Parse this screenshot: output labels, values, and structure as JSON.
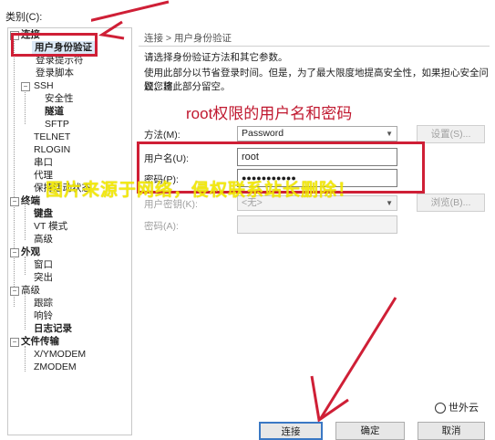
{
  "category_label": "类别(C):",
  "tree": [
    {
      "label": "连接",
      "bold": true
    },
    {
      "label": "用户身份验证",
      "bold": true,
      "selected": true
    },
    {
      "label": "登录提示符"
    },
    {
      "label": "登录脚本"
    },
    {
      "label": "SSH"
    },
    {
      "label": "安全性"
    },
    {
      "label": "隧道",
      "bold": true
    },
    {
      "label": "SFTP"
    },
    {
      "label": "TELNET"
    },
    {
      "label": "RLOGIN"
    },
    {
      "label": "串口"
    },
    {
      "label": "代理"
    },
    {
      "label": "保持活动状态"
    },
    {
      "label": "终端",
      "bold": true
    },
    {
      "label": "键盘",
      "bold": true
    },
    {
      "label": "VT 模式"
    },
    {
      "label": "高级"
    },
    {
      "label": "外观",
      "bold": true
    },
    {
      "label": "窗口"
    },
    {
      "label": "突出"
    },
    {
      "label": "高级"
    },
    {
      "label": "跟踪"
    },
    {
      "label": "响铃"
    },
    {
      "label": "日志记录",
      "bold": true
    },
    {
      "label": "文件传输",
      "bold": true
    },
    {
      "label": "X/YMODEM"
    },
    {
      "label": "ZMODEM"
    }
  ],
  "breadcrumb": "连接 > 用户身份验证",
  "desc1": "请选择身份验证方法和其它参数。",
  "desc2a": "使用此部分以节省登录时间。但是，为了最大限度地提高安全性，如果担心安全问题，建",
  "desc2b": "议您将此部分留空。",
  "annotation": "root权限的用户名和密码",
  "method": {
    "label": "方法(M):",
    "value": "Password",
    "settings_button": "设置(S)..."
  },
  "username": {
    "label": "用户名(U):",
    "value": "root"
  },
  "password": {
    "label": "密码(P):",
    "value": "●●●●●●●●●●●"
  },
  "user_key": {
    "label": "用户密钥(K):",
    "value": "<无>",
    "browse_button": "浏览(B)..."
  },
  "passphrase": {
    "label": "密码(A):",
    "value": ""
  },
  "buttons": {
    "connect": "连接",
    "ok": "确定",
    "cancel": "取消"
  },
  "watermark": "图片来源于网络，侵权联系站长删除！",
  "logo": "世外云",
  "colors": {
    "annotation_red": "#cf1f36",
    "watermark_yellow": "#f2e800",
    "selected_bg": "#dbe8f6"
  }
}
